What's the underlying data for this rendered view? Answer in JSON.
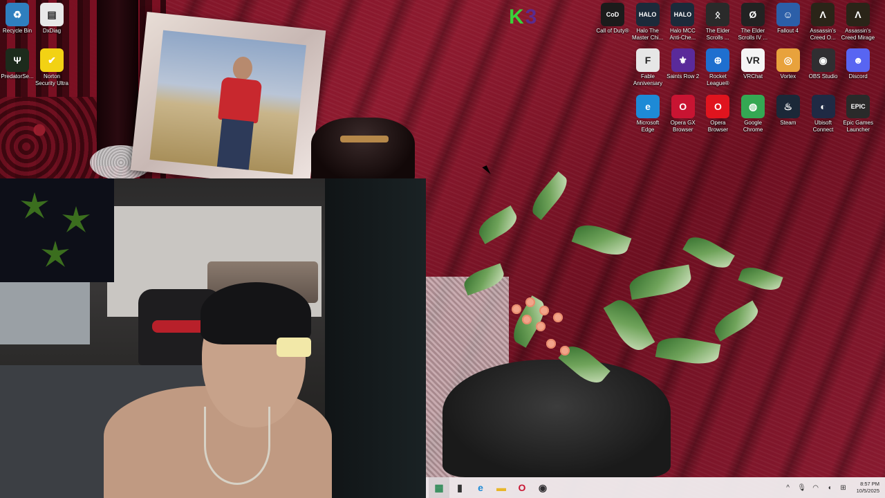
{
  "desktop": {
    "icons_left": [
      {
        "label": "Recycle Bin",
        "icon": "recycle-bin-icon",
        "color": "#2f7fbf",
        "glyph": "♻"
      },
      {
        "label": "DxDiag",
        "icon": "document-icon",
        "color": "#e8e8e8",
        "glyph": "▤"
      },
      {
        "label": "PredatorSe...",
        "icon": "predator-icon",
        "color": "#1c2b1c",
        "glyph": "Ψ"
      },
      {
        "label": "Norton Security Ultra",
        "icon": "norton-icon",
        "color": "#f2d214",
        "glyph": "✔"
      }
    ],
    "icons_grid_row1": [
      {
        "label": "Call of Duty®",
        "icon": "call-of-duty-icon",
        "color": "#1b1b1b",
        "glyph": "CoD"
      },
      {
        "label": "Halo The Master Chi...",
        "icon": "halo-mcc-icon",
        "color": "#1c2a3a",
        "glyph": "HALO"
      },
      {
        "label": "Halo MCC Anti-Che...",
        "icon": "halo-anticheat-icon",
        "color": "#1c2a3a",
        "glyph": "HALO"
      },
      {
        "label": "The Elder Scrolls ...",
        "icon": "elder-scrolls-icon",
        "color": "#2a2a2a",
        "glyph": "ᛟ"
      },
      {
        "label": "The Elder Scrolls IV ...",
        "icon": "oblivion-icon",
        "color": "#222",
        "glyph": "Ø"
      },
      {
        "label": "Fallout 4",
        "icon": "fallout-icon",
        "color": "#2c5fa8",
        "glyph": "☺"
      },
      {
        "label": "Assassin's Creed O...",
        "icon": "assassins-creed-origins-icon",
        "color": "#2a2418",
        "glyph": "Λ"
      },
      {
        "label": "Assassin's Creed Mirage",
        "icon": "assassins-creed-mirage-icon",
        "color": "#2a2418",
        "glyph": "Λ"
      }
    ],
    "icons_grid_row2": [
      {
        "label": "Fable Anniversary",
        "icon": "fable-icon",
        "color": "#e6e6e6",
        "glyph": "F"
      },
      {
        "label": "Saints Row 2",
        "icon": "saints-row-icon",
        "color": "#5a2a9a",
        "glyph": "⚜"
      },
      {
        "label": "Rocket League®",
        "icon": "rocket-league-icon",
        "color": "#1f6fcf",
        "glyph": "⊕"
      },
      {
        "label": "VRChat",
        "icon": "vrchat-icon",
        "color": "#f5f5f5",
        "glyph": "VR"
      },
      {
        "label": "Vortex",
        "icon": "vortex-icon",
        "color": "#e8a23c",
        "glyph": "◎"
      },
      {
        "label": "OBS Studio",
        "icon": "obs-icon",
        "color": "#302e31",
        "glyph": "◉"
      },
      {
        "label": "Discord",
        "icon": "discord-icon",
        "color": "#5865f2",
        "glyph": "☻"
      }
    ],
    "icons_grid_row3": [
      {
        "label": "Microsoft Edge",
        "icon": "edge-icon",
        "color": "#1e8ad6",
        "glyph": "e"
      },
      {
        "label": "Opera GX Browser",
        "icon": "opera-gx-icon",
        "color": "#c81432",
        "glyph": "O"
      },
      {
        "label": "Opera Browser",
        "icon": "opera-icon",
        "color": "#e0141e",
        "glyph": "O"
      },
      {
        "label": "Google Chrome",
        "icon": "chrome-icon",
        "color": "#34a853",
        "glyph": "◍"
      },
      {
        "label": "Steam",
        "icon": "steam-icon",
        "color": "#1b2838",
        "glyph": "♨"
      },
      {
        "label": "Ubisoft Connect",
        "icon": "ubisoft-icon",
        "color": "#1f2a44",
        "glyph": "◐"
      },
      {
        "label": "Epic Games Launcher",
        "icon": "epic-games-icon",
        "color": "#2a2a2a",
        "glyph": "EPIC"
      }
    ],
    "overlay_text": {
      "k": "K",
      "three": "3"
    }
  },
  "taskbar": {
    "pinned": [
      {
        "name": "taskbar-app-green",
        "icon": "green-app-icon",
        "glyph": "▦",
        "color": "#2e8b57"
      },
      {
        "name": "taskbar-terminal",
        "icon": "terminal-icon",
        "glyph": "▮",
        "color": "#333"
      },
      {
        "name": "taskbar-edge",
        "icon": "edge-icon",
        "glyph": "e",
        "color": "#1e8ad6"
      },
      {
        "name": "taskbar-file-explorer",
        "icon": "folder-icon",
        "glyph": "▬",
        "color": "#e8b62a"
      },
      {
        "name": "taskbar-opera-gx",
        "icon": "opera-gx-icon",
        "glyph": "O",
        "color": "#c81432"
      },
      {
        "name": "taskbar-obs",
        "icon": "obs-icon",
        "glyph": "◉",
        "color": "#302e31"
      }
    ],
    "tray": {
      "chevron": "^",
      "time": "8:57 PM",
      "date": "10/5/2025"
    }
  }
}
